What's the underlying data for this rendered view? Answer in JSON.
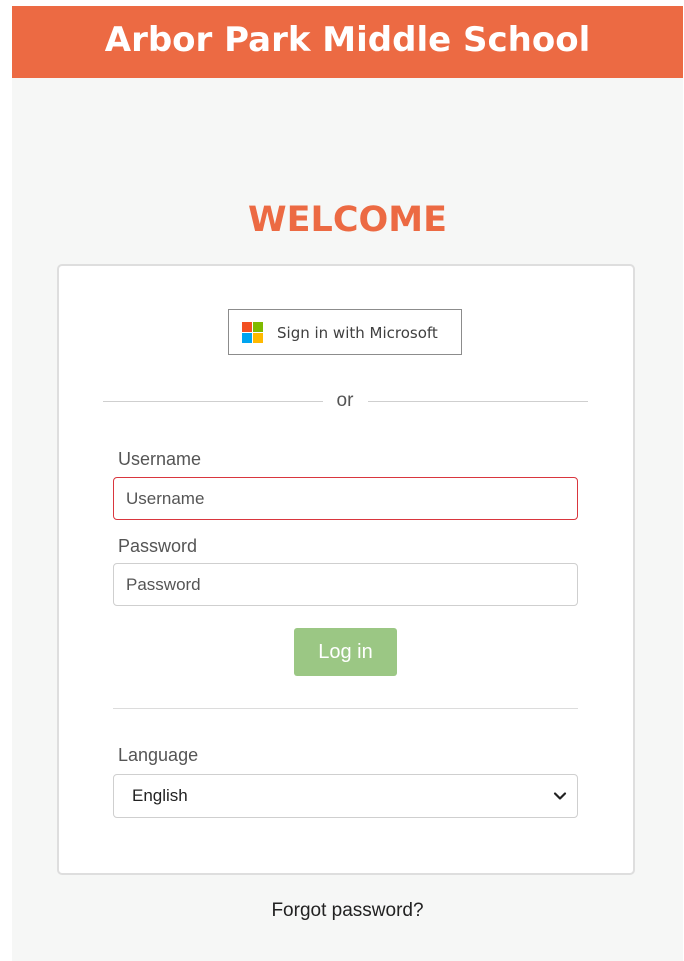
{
  "header": {
    "school_name": "Arbor Park Middle School",
    "brand_color": "#ec6a43"
  },
  "welcome": {
    "title": "WELCOME"
  },
  "login_card": {
    "microsoft_button": {
      "label": "Sign in with Microsoft",
      "icon": "microsoft-logo-icon",
      "logo_colors": [
        "#f25022",
        "#7fba00",
        "#00a4ef",
        "#ffb900"
      ]
    },
    "divider_text": "or",
    "username": {
      "label": "Username",
      "placeholder": "Username",
      "value": "",
      "focused": true
    },
    "password": {
      "label": "Password",
      "placeholder": "Password",
      "value": ""
    },
    "login_button": {
      "label": "Log in",
      "color": "#9bc784"
    },
    "language": {
      "label": "Language",
      "selected": "English",
      "icon": "chevron-down-icon"
    }
  },
  "forgot_password": {
    "label": "Forgot password?"
  }
}
